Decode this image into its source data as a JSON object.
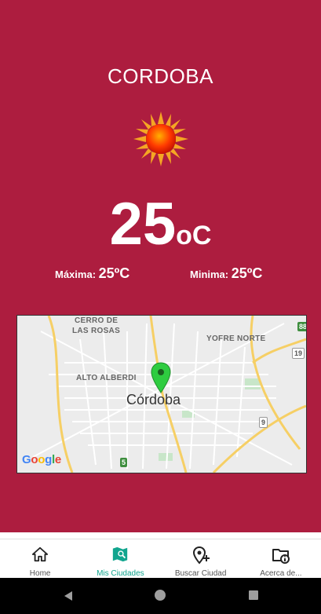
{
  "weather": {
    "city": "CORDOBA",
    "icon": "sun-icon",
    "temperature": "25",
    "unit": "oC",
    "max_label": "Máxima:",
    "max_value": "25ºC",
    "min_label": "Minima:",
    "min_value": "25ºC"
  },
  "map": {
    "city_label": "Córdoba",
    "neighborhoods": [
      "CERRO DE",
      "LAS ROSAS",
      "YOFRE NORTE",
      "ALTO ALBERDI"
    ],
    "shields": [
      "88",
      "19",
      "9",
      "5"
    ],
    "attribution": [
      "G",
      "o",
      "o",
      "g",
      "l",
      "e"
    ],
    "marker": "location-pin-icon"
  },
  "nav": {
    "items": [
      {
        "label": "Home",
        "icon": "home-icon"
      },
      {
        "label": "Mis Ciudades",
        "icon": "map-search-icon"
      },
      {
        "label": "Buscar Ciudad",
        "icon": "add-location-icon"
      },
      {
        "label": "Acerca de...",
        "icon": "folder-info-icon"
      }
    ],
    "active_color": "#11A58E"
  },
  "colors": {
    "background": "#AD1D3F"
  }
}
